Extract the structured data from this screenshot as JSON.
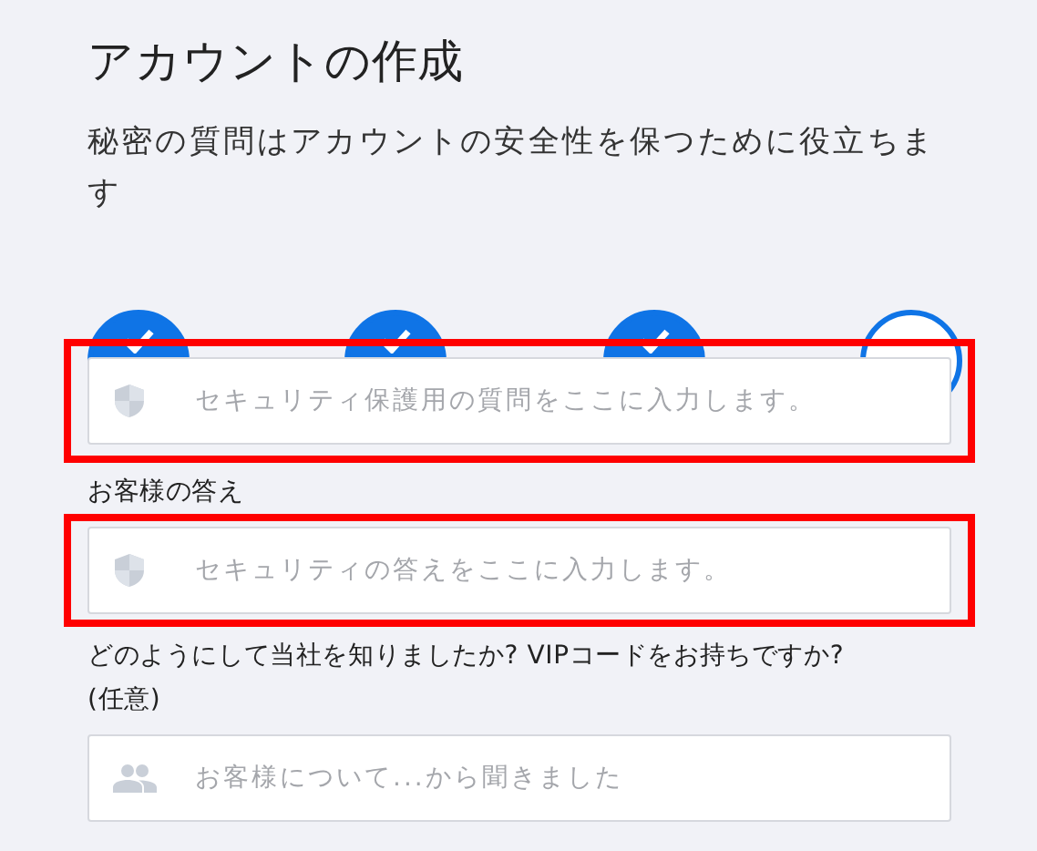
{
  "title": "アカウントの作成",
  "subtitle": "秘密の質問はアカウントの安全性を保つために役立ちます",
  "steps": [
    {
      "completed": true
    },
    {
      "completed": true
    },
    {
      "completed": true
    },
    {
      "completed": false
    }
  ],
  "fields": [
    {
      "kind": "shield",
      "placeholder": "セキュリティ保護用の質問をここに入力します。",
      "highlighted": true
    },
    {
      "kind": "shield",
      "label": "お客様の答え",
      "placeholder": "セキュリティの答えをここに入力します。",
      "highlighted": true
    },
    {
      "kind": "people",
      "label": "どのようにして当社を知りましたか? VIPコードをお持ちですか?",
      "note": "(任意)",
      "placeholder": "お客様について...から聞きました",
      "highlighted": false
    }
  ]
}
